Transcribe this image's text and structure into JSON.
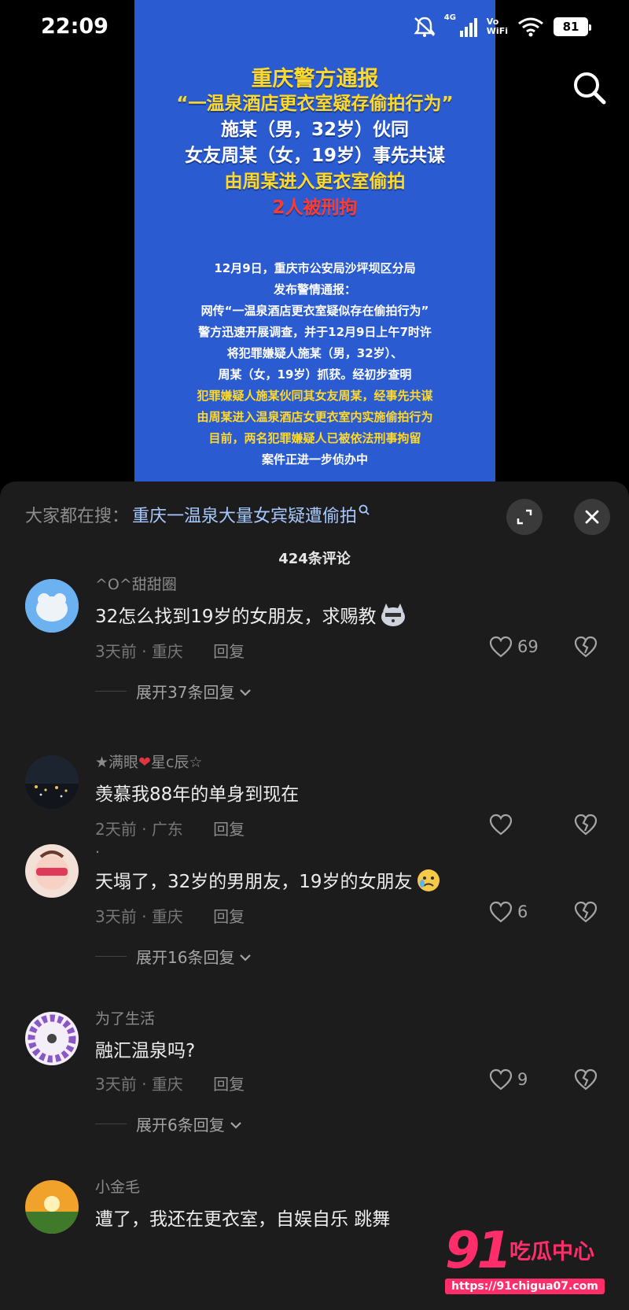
{
  "status_bar": {
    "time": "22:09",
    "network": "4G",
    "vowifi_top": "Vo",
    "vowifi_bottom": "WiFi",
    "battery": "81",
    "icons": [
      "mute-icon",
      "signal-icon",
      "vowifi-icon",
      "wifi-icon",
      "battery-icon"
    ]
  },
  "video": {
    "poster_title": "重庆警方通报",
    "poster_headline": [
      "“一温泉酒店更衣室疑存偷拍行为”",
      "施某（男，32岁）伙同",
      "女友周某（女，19岁）事先共谋",
      "由周某进入更衣室偷拍",
      "2人被刑拘"
    ],
    "poster_body": [
      "12月9日，重庆市公安局沙坪坝区分局",
      "发布警情通报：",
      "网传“一温泉酒店更衣室疑似存在偷拍行为”",
      "警方迅速开展调查，并于12月9日上午7时许",
      "将犯罪嫌疑人施某（男，32岁）、",
      "周某（女，19岁）抓获。经初步查明",
      "犯罪嫌疑人施某伙同其女友周某，经事先共谋",
      "由周某进入温泉酒店女更衣室内实施偷拍行为",
      "目前，两名犯罪嫌疑人已被依法刑事拘留",
      "案件正进一步侦办中"
    ],
    "search_icon": "search-icon"
  },
  "comments_panel": {
    "hot_search_prefix": "大家都在搜：",
    "hot_search_query": "重庆一温泉大量女宾疑遭偷拍",
    "count_label": "424条评论",
    "reply_label": "回复",
    "comments": [
      {
        "user": "^O^甜甜圈",
        "text": "32怎么找到19岁的女朋友，求赐教",
        "emoji": "cat-emoji",
        "time": "3天前",
        "location": "重庆",
        "likes": "69",
        "expand": "展开37条回复"
      },
      {
        "user_prefix": "★满眼",
        "user_suffix": "星c辰☆",
        "text": "羡慕我88年的单身到现在",
        "time": "2天前",
        "location": "广东",
        "likes": "",
        "expand": ""
      },
      {
        "user": ".",
        "text": "天塌了，32岁的男朋友，19岁的女朋友",
        "emoji": "crying-emoji",
        "time": "3天前",
        "location": "重庆",
        "likes": "6",
        "expand": "展开16条回复"
      },
      {
        "user": "为了生活",
        "text": "融汇温泉吗?",
        "time": "3天前",
        "location": "重庆",
        "likes": "9",
        "expand": "展开6条回复"
      },
      {
        "user": "小金毛",
        "text": "遭了，我还在更衣室，自娱自乐 跳舞",
        "time": "",
        "location": "",
        "likes": "",
        "expand": ""
      }
    ]
  },
  "watermark": {
    "number": "91",
    "brand": "吃瓜中心",
    "url": "https://91chigua07.com"
  },
  "colors": {
    "poster_blue": "#2b5bd1",
    "poster_yellow": "#ffd92a",
    "poster_red": "#ff3b30",
    "sheet_bg": "#1c1c1c",
    "link_blue": "#a6c8ff",
    "watermark_pink": "#ff2e6b"
  }
}
